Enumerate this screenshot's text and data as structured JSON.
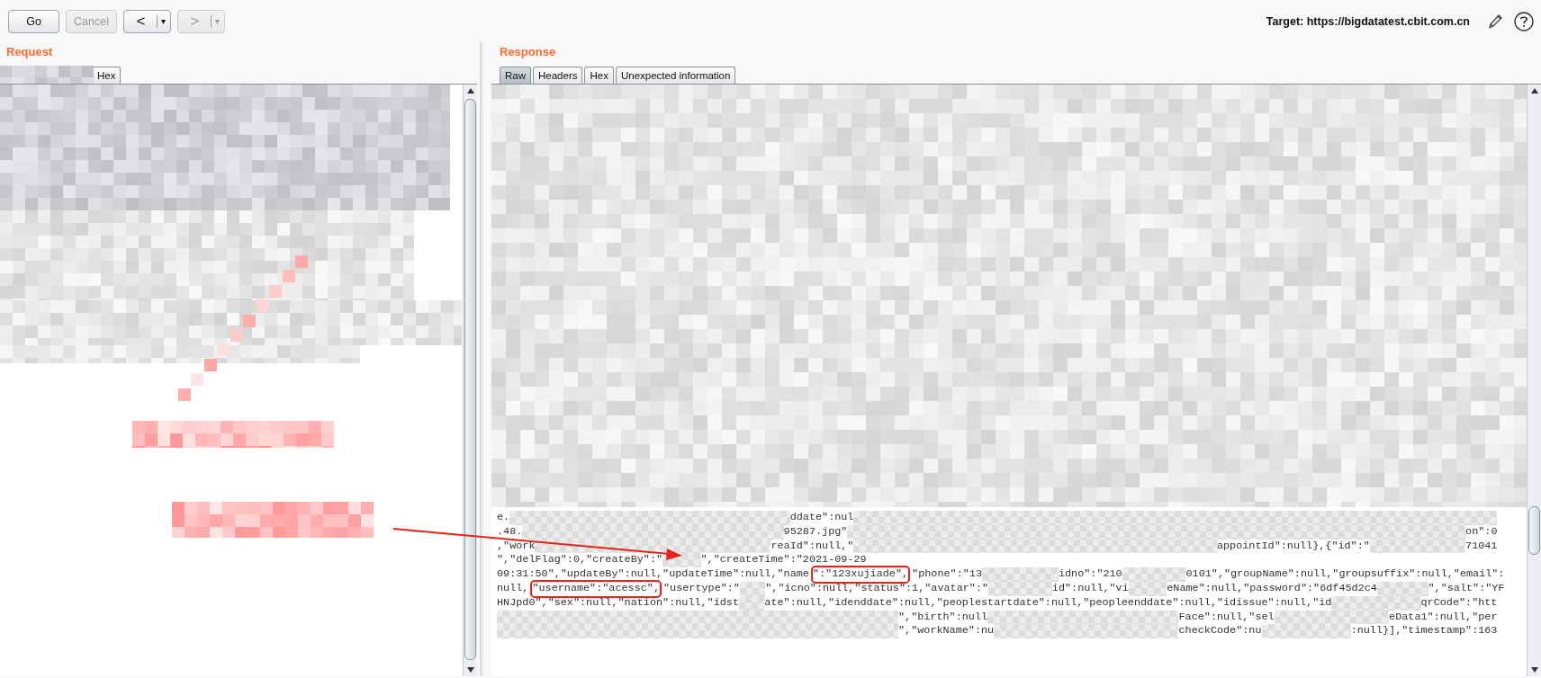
{
  "toolbar": {
    "buttons": [
      {
        "kind": "text",
        "label": "Go",
        "disabled": false
      },
      {
        "kind": "text",
        "label": "Cancel",
        "disabled": true
      },
      {
        "kind": "nav",
        "label": "<",
        "menu": "▾",
        "disabled": false
      },
      {
        "kind": "nav",
        "label": ">",
        "menu": "▾",
        "disabled": true
      }
    ],
    "target": "Target: https://bigdatatest.cbit.com.cn"
  },
  "request": {
    "title": "Request",
    "tabs": [
      {
        "label": "Hex",
        "selected": false
      }
    ]
  },
  "response": {
    "title": "Response",
    "tabs": [
      {
        "label": "Raw",
        "selected": true
      },
      {
        "label": "Headers",
        "selected": false
      },
      {
        "label": "Hex",
        "selected": false
      },
      {
        "label": "Unexpected information",
        "selected": false
      }
    ],
    "lines": [
      {
        "segments": [
          {
            "text": "e.",
            "highlighted": false
          },
          {
            "text": "ddate\":nul",
            "highlighted": false
          }
        ]
      },
      {
        "segments": [
          {
            "text": ".48.",
            "highlighted": false
          },
          {
            "text": "95287.jpg\"",
            "highlighted": false
          },
          {
            "text": "on\":0",
            "highlighted": false
          }
        ]
      },
      {
        "segments": [
          {
            "text": ",\"work",
            "highlighted": false
          },
          {
            "text": "reaId\":null,\"",
            "highlighted": false
          },
          {
            "text": "appointId\":null},{\"id\":\"",
            "highlighted": false
          },
          {
            "text": "71041",
            "highlighted": false
          }
        ]
      },
      {
        "segments": [
          {
            "text": "\",\"delFlag\":0,\"createBy\":\"",
            "highlighted": false
          },
          {
            "text": "\",\"createTime\":\"2021-09-29",
            "highlighted": false
          }
        ]
      },
      {
        "segments": [
          {
            "text": "09:31:50\",\"updateBy\":null,\"updateTime\":null,\"name",
            "highlighted": false
          },
          {
            "text": "\":\"123xujiade\",",
            "highlighted": true
          },
          {
            "text": "\"phone\":\"13",
            "highlighted": false
          },
          {
            "text": "idno\":\"210",
            "highlighted": false
          },
          {
            "text": "0101\",\"groupName\":null,\"groupsuffix\":null,\"email\":",
            "highlighted": false
          }
        ]
      },
      {
        "segments": [
          {
            "text": "null,",
            "highlighted": false
          },
          {
            "text": "\"username\":\"acessc\",",
            "highlighted": true
          },
          {
            "text": "\"usertype\":\"",
            "highlighted": false
          },
          {
            "text": "\",\"icno\":null,\"status\":1,\"avatar\":\"",
            "highlighted": false
          },
          {
            "text": "id\":null,\"vi",
            "highlighted": false
          },
          {
            "text": "eName\":null,\"password\":\"6df45d2c4",
            "highlighted": false
          },
          {
            "text": "\",\"salt\":\"YF",
            "highlighted": false
          }
        ]
      },
      {
        "segments": [
          {
            "text": "HNJpd0\",\"sex\":null,\"nation\":null,\"idst",
            "highlighted": false
          },
          {
            "text": "ate\":null,\"idenddate\":null,\"peoplestartdate\":null,\"peopleenddate\":null,\"idissue\":null,\"id",
            "highlighted": false
          },
          {
            "text": "qrCode\":\"htt",
            "highlighted": false
          }
        ]
      },
      {
        "segments": [
          {
            "text": "\",\"birth\":null",
            "highlighted": false
          },
          {
            "text": "Face\":null,\"sel",
            "highlighted": false
          },
          {
            "text": "eData1\":null,\"per",
            "highlighted": false
          }
        ]
      },
      {
        "segments": [
          {
            "text": "\",\"workName\":nu",
            "highlighted": false
          },
          {
            "text": "checkCode\":nu",
            "highlighted": false
          },
          {
            "text": ":null}],\"timestamp\":163",
            "highlighted": false
          }
        ]
      }
    ]
  }
}
